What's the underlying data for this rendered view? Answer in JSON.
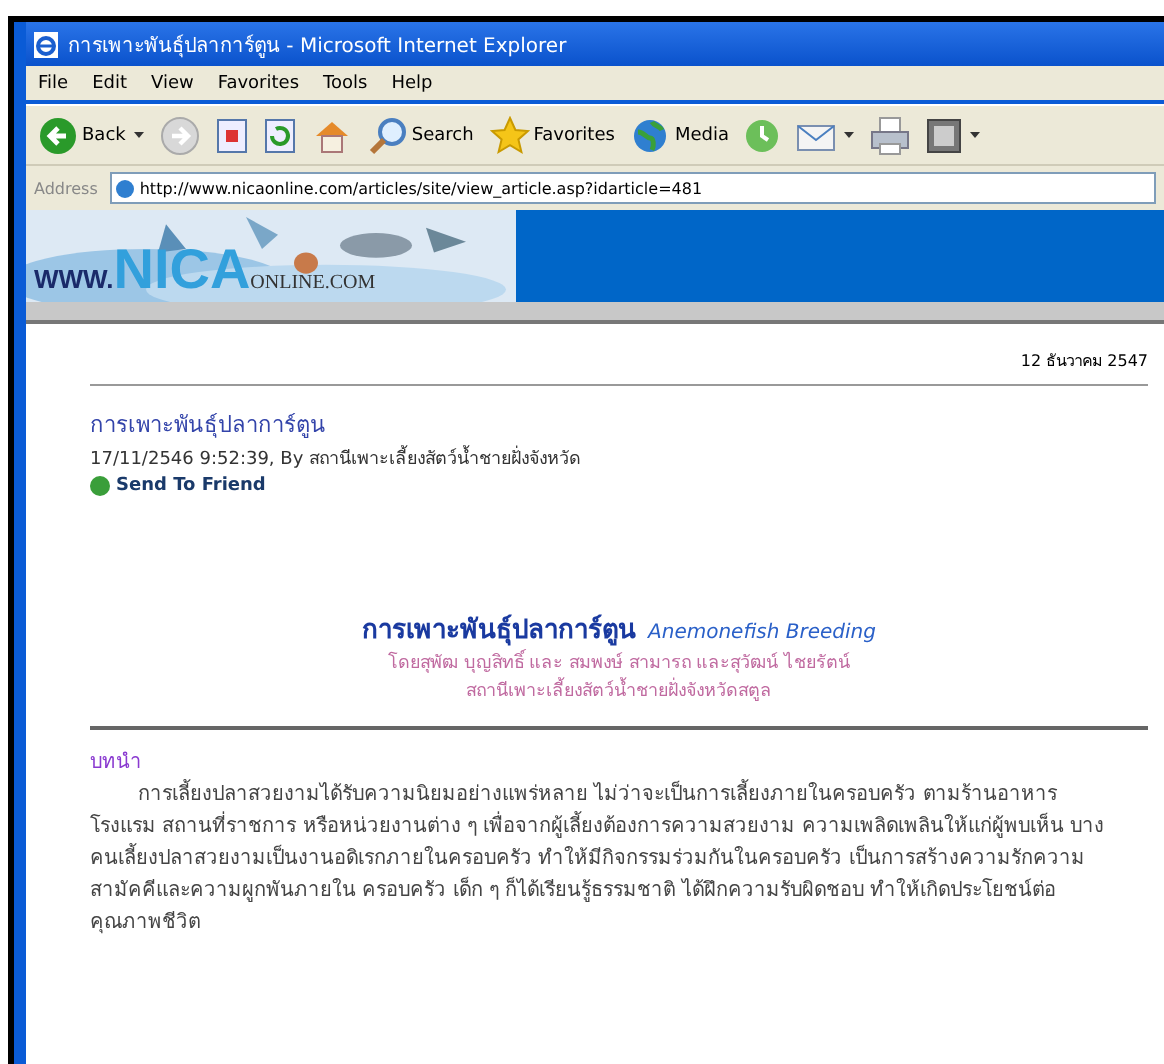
{
  "window": {
    "title": "การเพาะพันธุ์ปลาการ์ตูน - Microsoft Internet Explorer"
  },
  "menu": [
    "File",
    "Edit",
    "View",
    "Favorites",
    "Tools",
    "Help"
  ],
  "toolbar": [
    {
      "kind": "back",
      "label": "Back",
      "dropdown": true
    },
    {
      "kind": "forward",
      "dropdown": false
    },
    {
      "kind": "stop",
      "dropdown": false
    },
    {
      "kind": "refresh",
      "dropdown": false
    },
    {
      "kind": "home",
      "dropdown": false
    },
    {
      "kind": "search",
      "label": "Search",
      "dropdown": false
    },
    {
      "kind": "favorites",
      "label": "Favorites",
      "dropdown": false
    },
    {
      "kind": "media",
      "label": "Media",
      "dropdown": false
    },
    {
      "kind": "history",
      "dropdown": false
    },
    {
      "kind": "mail",
      "dropdown": true
    },
    {
      "kind": "print",
      "dropdown": false
    },
    {
      "kind": "edit",
      "dropdown": true
    }
  ],
  "address": {
    "label": "Address",
    "value": "http://www.nicaonline.com/articles/site/view_article.asp?idarticle=481"
  },
  "banner": {
    "logo_prefix": "WWW.",
    "logo_main": "NICA",
    "logo_suffix": "ONLINE.COM"
  },
  "article": {
    "date": "12 ธันวาคม 2547",
    "title_link": "การเพาะพันธุ์ปลาการ์ตูน",
    "meta": "17/11/2546 9:52:39, By สถานีเพาะเลี้ยงสัตว์น้ำชายฝั่งจังหวัด",
    "send_link": "Send To Friend",
    "heading": "การเพาะพันธุ์ปลาการ์ตูน",
    "heading_en": "Anemonefish Breeding",
    "subtitle": [
      "โดยสุพัฒ บุญสิทธิ์ และ สมพงษ์ สามารถ และสุวัฒน์ ไชยรัตน์",
      "สถานีเพาะเลี้ยงสัตว์น้ำชายฝั่งจังหวัดสตูล"
    ],
    "section": "บทนำ",
    "paragraph": "การเลี้ยงปลาสวยงามได้รับความนิยมอย่างแพร่หลาย ไม่ว่าจะเป็นการเลี้ยงภายในครอบครัว ตามร้านอาหาร โรงแรม สถานที่ราชการ หรือหน่วยงานต่าง ๆ เพื่อจากผู้เลี้ยงต้องการความสวยงาม ความเพลิดเพลินให้แก่ผู้พบเห็น บางคนเลี้ยงปลาสวยงามเป็นงานอดิเรกภายในครอบครัว ทำให้มีกิจกรรมร่วมกันในครอบครัว เป็นการสร้างความรักความสามัคคีและความผูกพันภายใน ครอบครัว เด็ก ๆ ก็ได้เรียนรู้ธรรมชาติ ได้ฝึกความรับผิดชอบ ทำให้เกิดประโยชน์ต่อคุณภาพชีวิต"
  }
}
